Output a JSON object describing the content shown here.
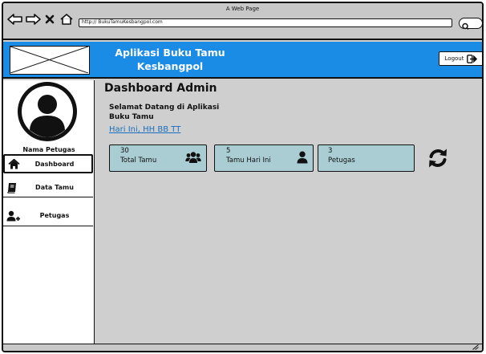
{
  "window": {
    "title": "A Web Page"
  },
  "browser": {
    "url": "http:// BukuTamuKesbangpol.com"
  },
  "header": {
    "app_title_line1": "Aplikasi Buku Tamu",
    "app_title_line2": "Kesbangpol",
    "logout_label": "Logout",
    "brand_color": "#1a8ce6"
  },
  "sidebar": {
    "user_name": "Nama Petugas",
    "items": [
      {
        "label": "Dashboard",
        "icon": "home-icon",
        "active": true
      },
      {
        "label": "Data Tamu",
        "icon": "book-icon",
        "active": false
      },
      {
        "label": "Petugas",
        "icon": "add-user-icon",
        "active": false
      }
    ]
  },
  "main": {
    "title": "Dashboard Admin",
    "welcome_line1": "Selamat Datang di Aplikasi",
    "welcome_line2": "Buku Tamu",
    "date_text": "Hari Ini, HH BB TT",
    "cards": [
      {
        "value": "30",
        "label": "Total Tamu",
        "icon": "users-icon"
      },
      {
        "value": "5",
        "label": "Tamu Hari Ini",
        "icon": "user-icon"
      },
      {
        "value": "3",
        "label": "Petugas",
        "icon": ""
      }
    ],
    "card_color": "#a9cdd3",
    "refresh_icon": "refresh-icon"
  }
}
